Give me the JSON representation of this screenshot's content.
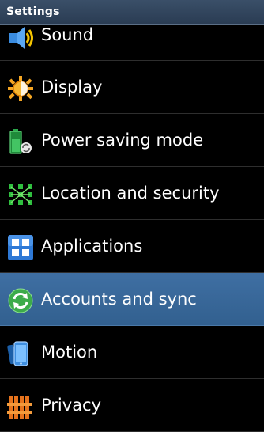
{
  "header": {
    "title": "Settings"
  },
  "menu": {
    "items": [
      {
        "label": "Sound",
        "icon": "speaker-icon"
      },
      {
        "label": "Display",
        "icon": "brightness-icon"
      },
      {
        "label": "Power saving mode",
        "icon": "battery-recycle-icon"
      },
      {
        "label": "Location and security",
        "icon": "location-grid-icon"
      },
      {
        "label": "Applications",
        "icon": "applications-grid-icon"
      },
      {
        "label": "Accounts and sync",
        "icon": "sync-icon"
      },
      {
        "label": "Motion",
        "icon": "phone-motion-icon"
      },
      {
        "label": "Privacy",
        "icon": "privacy-icon"
      }
    ],
    "selected_index": 5
  },
  "colors": {
    "background": "#000000",
    "title_bar": "#34485f",
    "selected_row": "#3a6a9d",
    "text": "#ffffff"
  }
}
